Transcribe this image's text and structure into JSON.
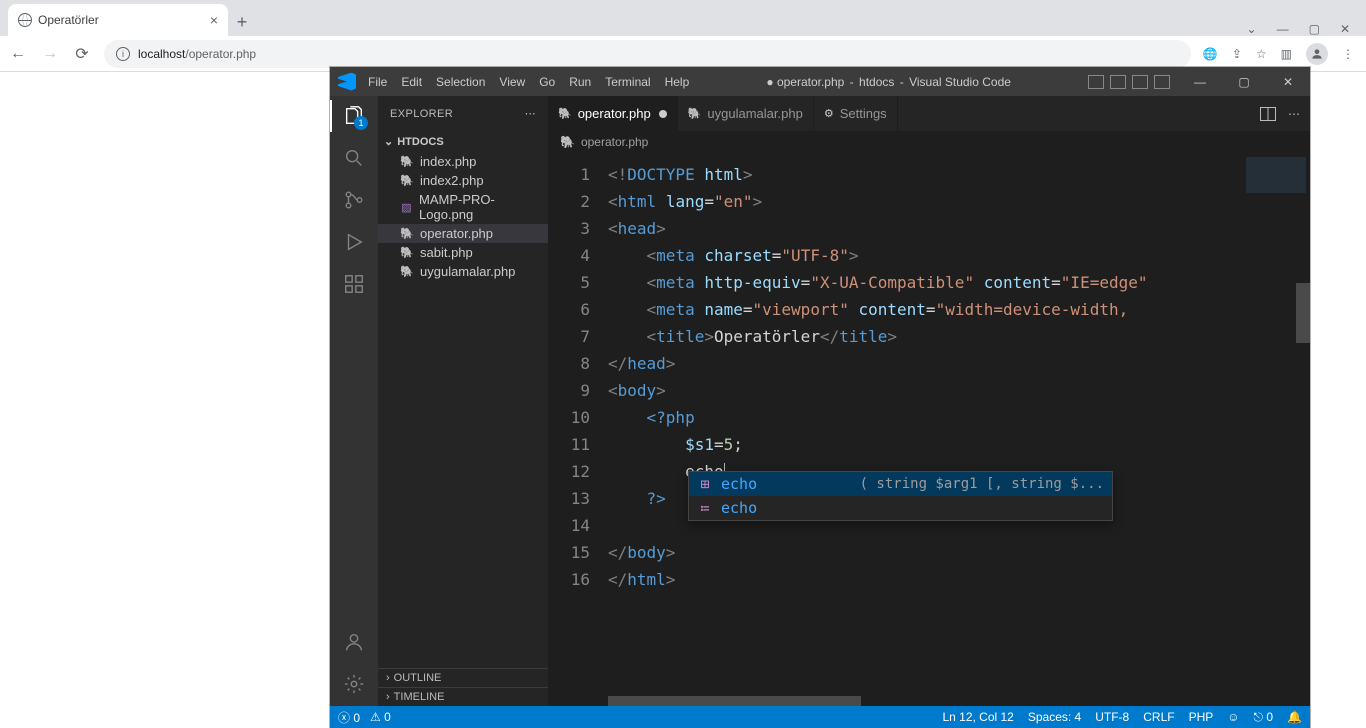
{
  "browser": {
    "tab_title": "Operatörler",
    "url_host": "localhost",
    "url_path": "/operator.php"
  },
  "vscode": {
    "menu": [
      "File",
      "Edit",
      "Selection",
      "View",
      "Go",
      "Run",
      "Terminal",
      "Help"
    ],
    "title_dirty_dot": "●",
    "title_filename": "operator.php",
    "title_sep": "-",
    "title_workspace": "htdocs",
    "title_app": "Visual Studio Code",
    "explorer_label": "EXPLORER",
    "workspace_root": "HTDOCS",
    "files": [
      {
        "name": "index.php",
        "icon": "php"
      },
      {
        "name": "index2.php",
        "icon": "php"
      },
      {
        "name": "MAMP-PRO-Logo.png",
        "icon": "img"
      },
      {
        "name": "operator.php",
        "icon": "php",
        "active": true
      },
      {
        "name": "sabit.php",
        "icon": "php"
      },
      {
        "name": "uygulamalar.php",
        "icon": "php"
      }
    ],
    "outline_label": "OUTLINE",
    "timeline_label": "TIMELINE",
    "tabs": [
      {
        "label": "operator.php",
        "icon": "php",
        "active": true,
        "dirty": true
      },
      {
        "label": "uygulamalar.php",
        "icon": "php"
      },
      {
        "label": "Settings",
        "icon": "gear"
      }
    ],
    "breadcrumb": {
      "icon": "php",
      "text": "operator.php"
    },
    "activity_badge": "1",
    "autocomplete": {
      "items": [
        {
          "kind": "func",
          "label": "echo",
          "signature": "( string $arg1 [, string $...",
          "selected": true
        },
        {
          "kind": "snippet",
          "label": "echo"
        }
      ]
    },
    "status": {
      "errors": "0",
      "warnings": "0",
      "cursor": "Ln 12, Col 12",
      "spaces": "Spaces: 4",
      "encoding": "UTF-8",
      "eol": "CRLF",
      "lang": "PHP",
      "port": "0"
    }
  },
  "code": {
    "lines": [
      1,
      2,
      3,
      4,
      5,
      6,
      7,
      8,
      9,
      10,
      11,
      12,
      13,
      14,
      15,
      16
    ]
  }
}
